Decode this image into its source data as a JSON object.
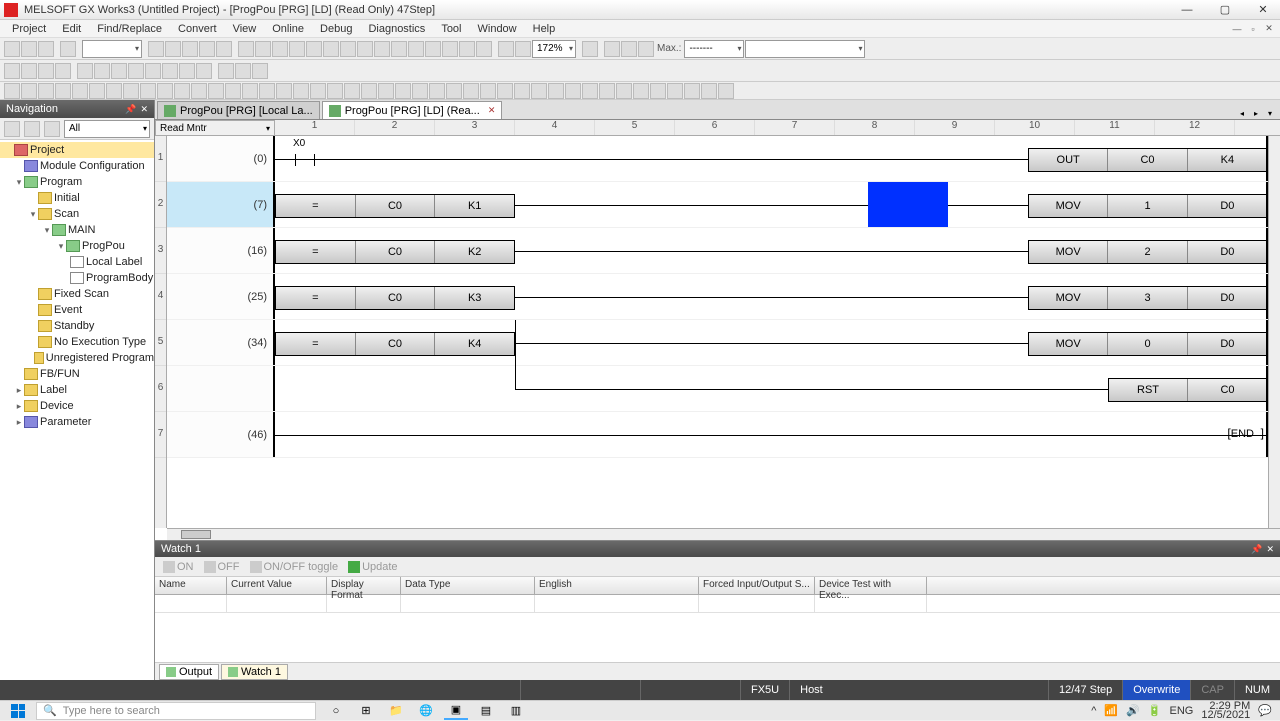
{
  "title": "MELSOFT GX Works3 (Untitled Project) - [ProgPou [PRG] [LD] (Read Only) 47Step]",
  "menus": [
    "Project",
    "Edit",
    "Find/Replace",
    "Convert",
    "View",
    "Online",
    "Debug",
    "Diagnostics",
    "Tool",
    "Window",
    "Help"
  ],
  "toolbar": {
    "zoom": "172%",
    "max_label": "Max.:",
    "max_value": "-------"
  },
  "nav": {
    "title": "Navigation",
    "filter": "All",
    "tree": {
      "project": "Project",
      "module_config": "Module Configuration",
      "program": "Program",
      "initial": "Initial",
      "scan": "Scan",
      "main": "MAIN",
      "progpou": "ProgPou",
      "local_label": "Local Label",
      "program_body": "ProgramBody",
      "fixed_scan": "Fixed Scan",
      "event": "Event",
      "standby": "Standby",
      "no_exec": "No Execution Type",
      "unreg": "Unregistered Program",
      "fbfun": "FB/FUN",
      "label": "Label",
      "device": "Device",
      "parameter": "Parameter"
    }
  },
  "tabs": {
    "t1": "ProgPou [PRG] [Local La...",
    "t2": "ProgPou [PRG] [LD] (Rea..."
  },
  "ladder": {
    "mode": "Read Mntr",
    "cols": [
      "1",
      "2",
      "3",
      "4",
      "5",
      "6",
      "7",
      "8",
      "9",
      "10",
      "11",
      "12"
    ],
    "rows": [
      "1",
      "2",
      "3",
      "4",
      "5",
      "6",
      "7"
    ],
    "rungs": [
      {
        "step": "(0)",
        "contact": "X0",
        "instr": "OUT",
        "ops": [
          "C0",
          "K4"
        ]
      },
      {
        "step": "(7)",
        "cmp": [
          "=",
          "C0",
          "K1"
        ],
        "instr": "MOV",
        "ops": [
          "1",
          "D0"
        ]
      },
      {
        "step": "(16)",
        "cmp": [
          "=",
          "C0",
          "K2"
        ],
        "instr": "MOV",
        "ops": [
          "2",
          "D0"
        ]
      },
      {
        "step": "(25)",
        "cmp": [
          "=",
          "C0",
          "K3"
        ],
        "instr": "MOV",
        "ops": [
          "3",
          "D0"
        ]
      },
      {
        "step": "(34)",
        "cmp": [
          "=",
          "C0",
          "K4"
        ],
        "instr": "MOV",
        "ops": [
          "0",
          "D0"
        ]
      },
      {
        "step": "",
        "instr": "RST",
        "ops": [
          "C0"
        ]
      },
      {
        "step": "(46)",
        "end": "END"
      }
    ]
  },
  "watch": {
    "title": "Watch 1",
    "buttons": {
      "on": "ON",
      "off": "OFF",
      "toggle": "ON/OFF toggle",
      "update": "Update"
    },
    "cols": [
      "Name",
      "Current Value",
      "Display Format",
      "Data Type",
      "English",
      "Forced Input/Output S...",
      "Device Test with Exec..."
    ],
    "bottom_tabs": {
      "output": "Output",
      "watch1": "Watch 1"
    }
  },
  "status": {
    "cpu": "FX5U",
    "host": "Host",
    "step": "12/47 Step",
    "overwrite": "Overwrite",
    "cap": "CAP",
    "num": "NUM"
  },
  "taskbar": {
    "search": "Type here to search",
    "lang": "ENG",
    "time": "2:29 PM",
    "date": "12/5/2021"
  }
}
